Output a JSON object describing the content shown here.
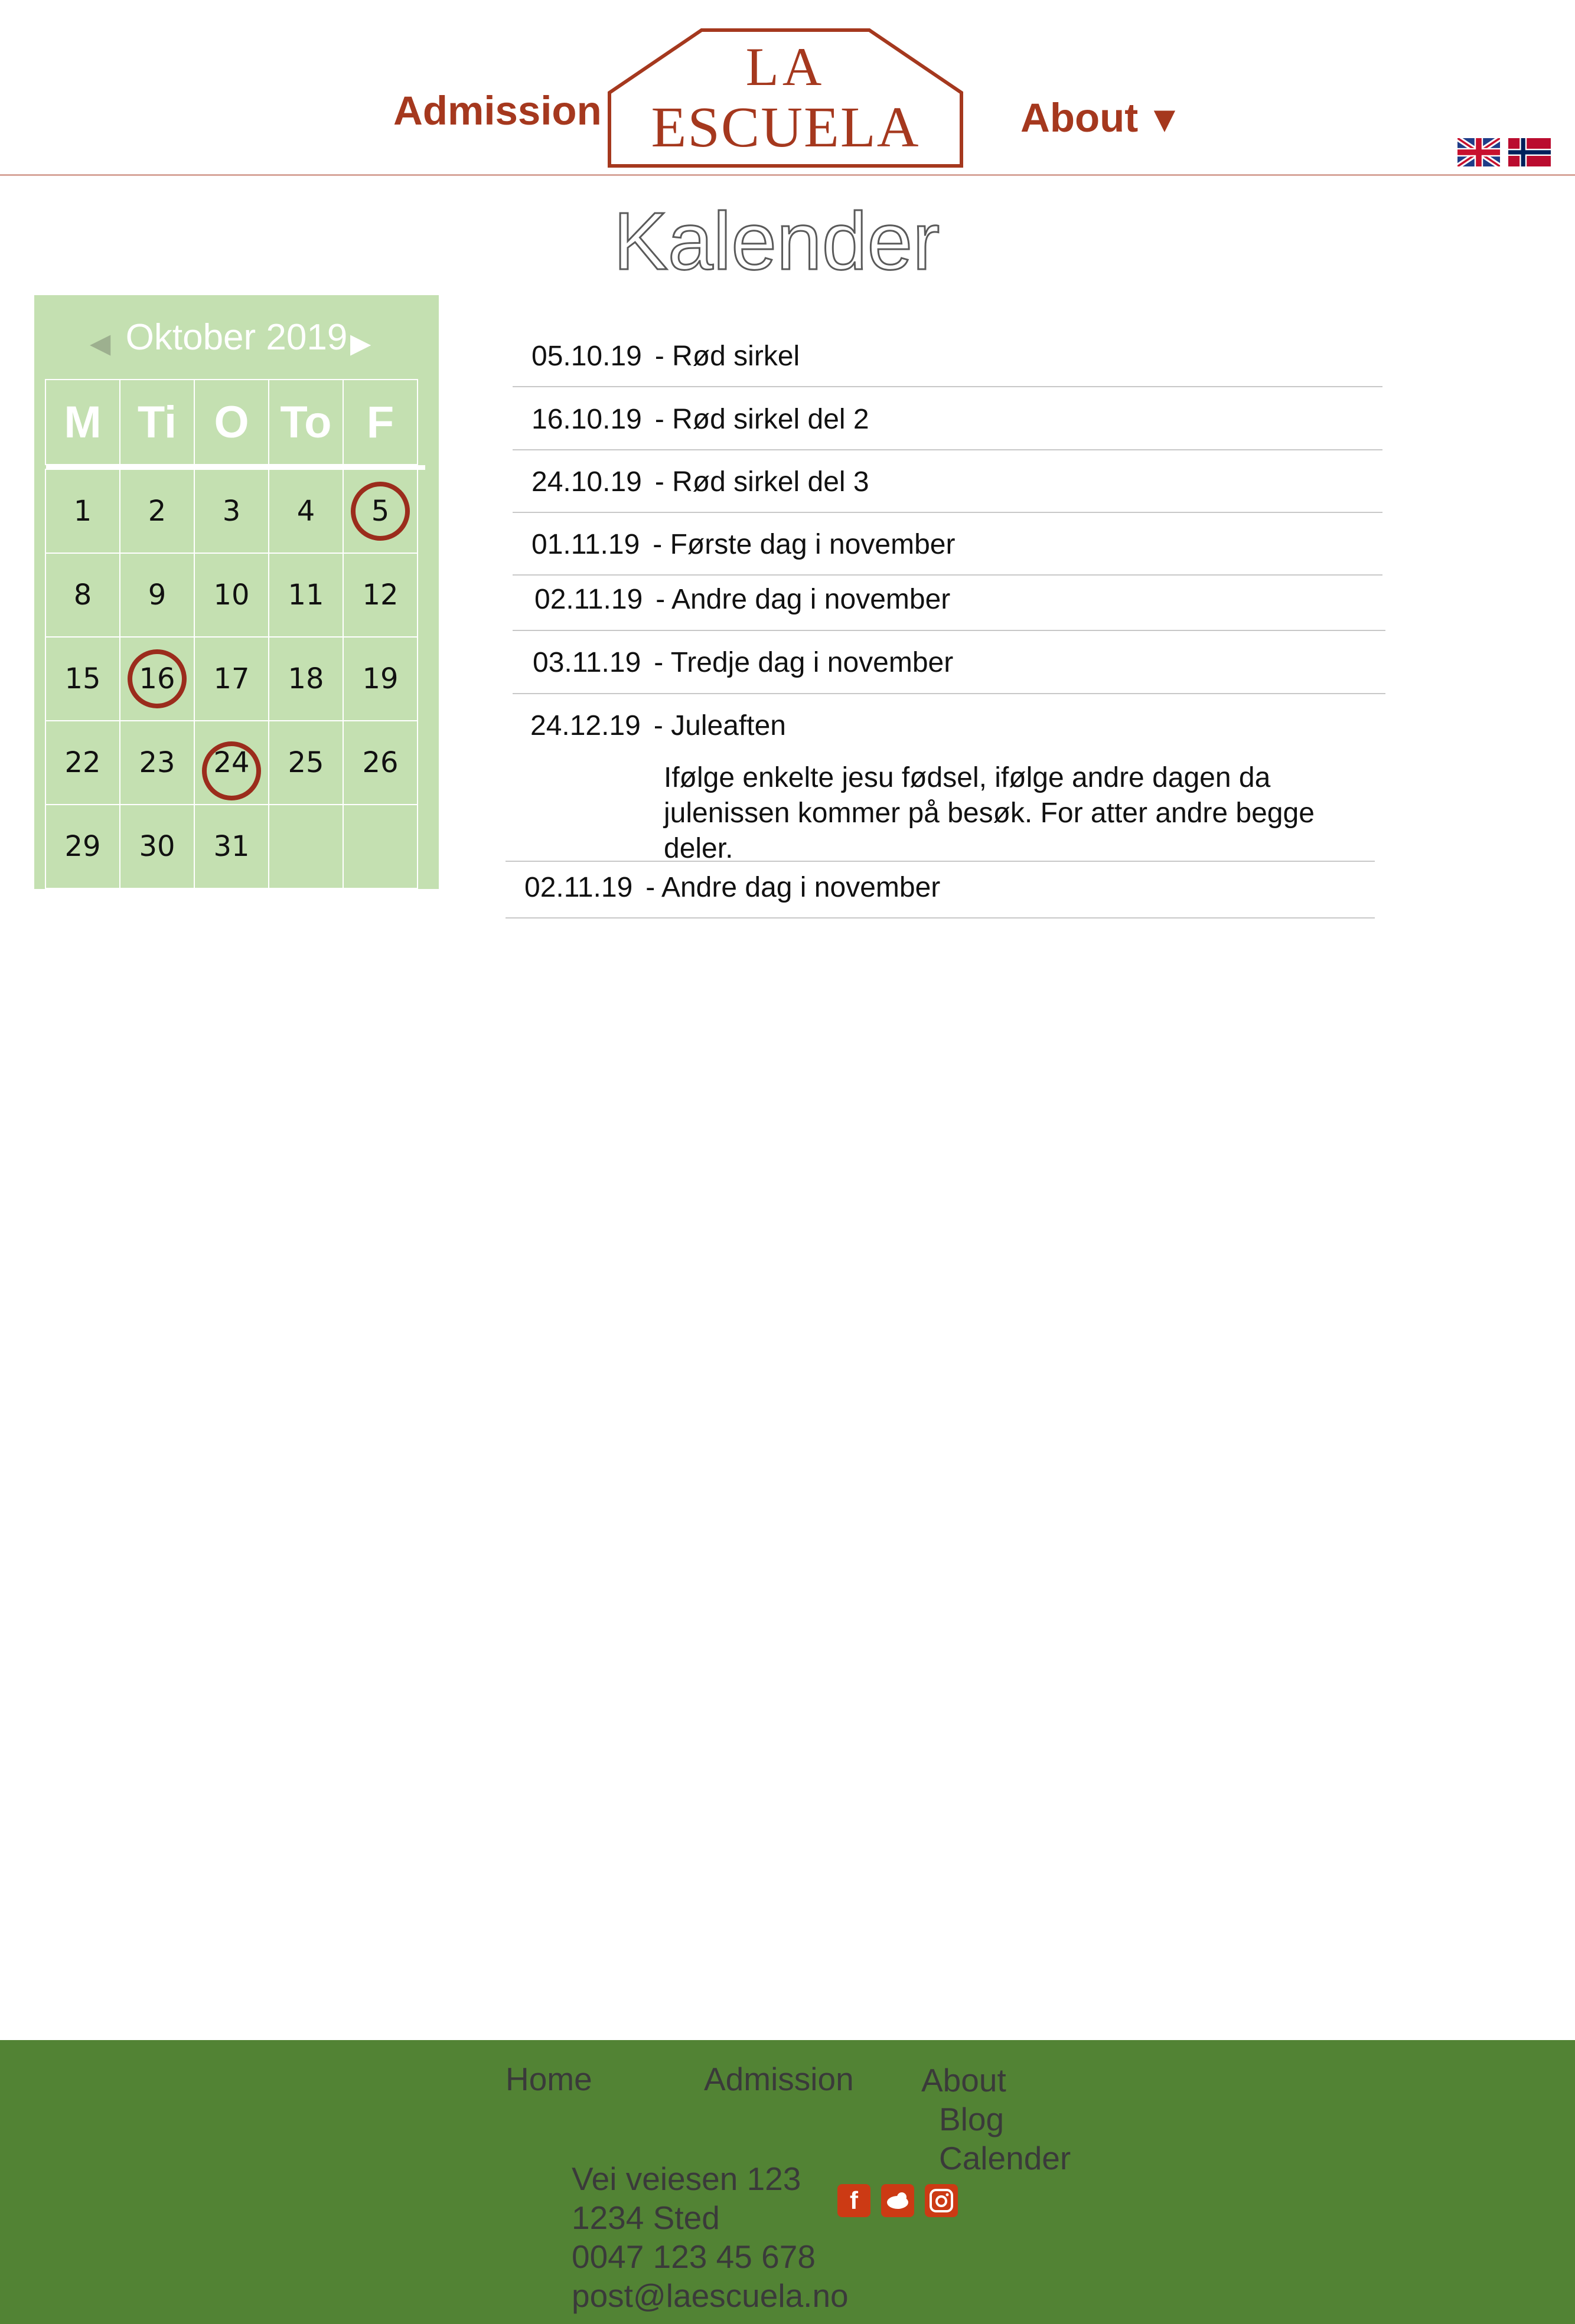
{
  "header": {
    "nav_admission": "Admission",
    "nav_about": "About",
    "about_arrow": "▼",
    "logo_line1": "LA",
    "logo_line2": "ESCUELA",
    "brand_color": "#a5381e",
    "flags": [
      "uk-flag-icon",
      "norway-flag-icon"
    ]
  },
  "page": {
    "title": "Kalender"
  },
  "calendar": {
    "month_label": "Oktober 2019",
    "prev": "◀",
    "next": "▶",
    "day_headers": [
      "M",
      "Ti",
      "O",
      "To",
      "F"
    ],
    "weeks": [
      [
        "1",
        "2",
        "3",
        "4",
        "5"
      ],
      [
        "8",
        "9",
        "10",
        "11",
        "12"
      ],
      [
        "15",
        "16",
        "17",
        "18",
        "19"
      ],
      [
        "22",
        "23",
        "24",
        "25",
        "26"
      ],
      [
        "29",
        "30",
        "31",
        "",
        ""
      ]
    ],
    "marked_days": [
      "5",
      "16",
      "24"
    ],
    "background": "#c4e0b1",
    "marker_color": "#9b2c1c"
  },
  "events": [
    {
      "date": "05.10.19",
      "title": "- Rød sirkel"
    },
    {
      "date": "16.10.19",
      "title": "- Rød sirkel del 2"
    },
    {
      "date": "24.10.19",
      "title": "- Rød sirkel del 3"
    },
    {
      "date": "01.11.19",
      "title": "- Første dag i november"
    },
    {
      "date": "02.11.19",
      "title": "- Andre dag i november"
    },
    {
      "date": "03.11.19",
      "title": "- Tredje dag i november"
    },
    {
      "date": "24.12.19",
      "title": "- Juleaften",
      "description": "Ifølge enkelte jesu fødsel, ifølge andre dagen da julenissen kommer på besøk. For atter andre begge deler."
    },
    {
      "date": "02.11.19",
      "title": "- Andre dag i november"
    }
  ],
  "footer": {
    "nav": {
      "home": "Home",
      "admission": "Admission",
      "about": "About",
      "blog": "Blog",
      "calender": "Calender"
    },
    "address": [
      "Vei veiesen 123",
      "1234 Sted",
      "0047 123 45 678",
      "post@laescuela.no"
    ],
    "social": [
      "facebook-icon",
      "twitter-bird-icon",
      "instagram-icon"
    ],
    "background": "#528334"
  }
}
